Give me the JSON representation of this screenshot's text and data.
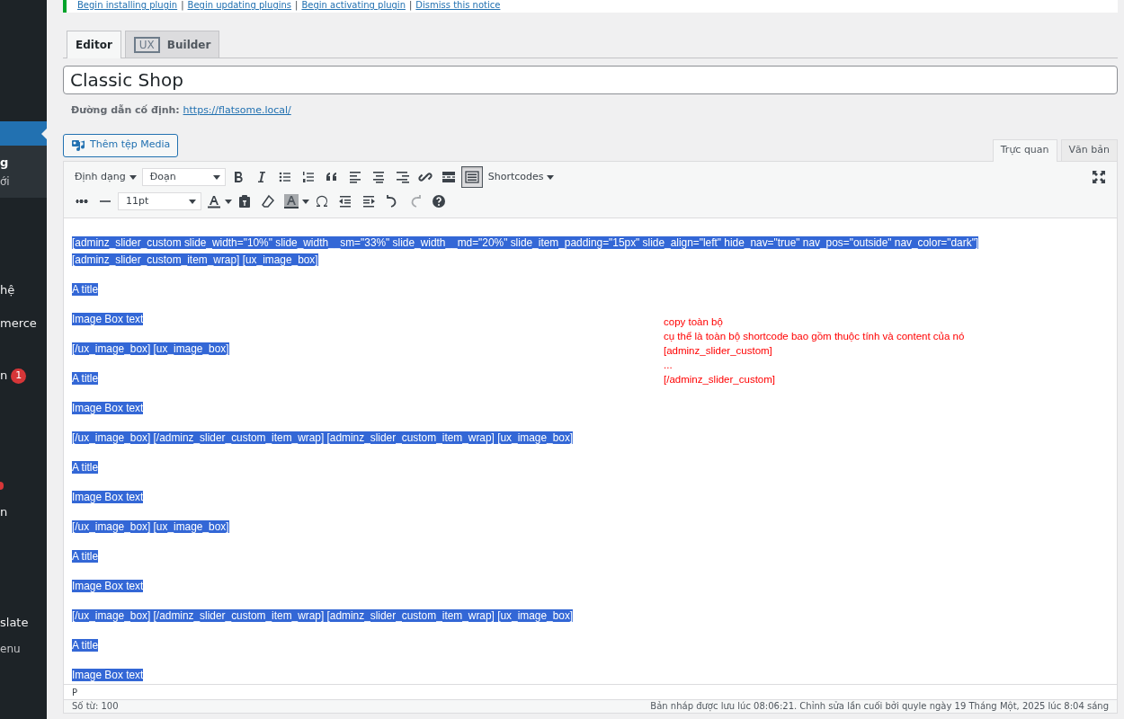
{
  "notice": {
    "links": [
      "Begin installing plugin",
      "Begin updating plugins",
      "Begin activating plugin",
      "Dismiss this notice"
    ],
    "separator": "|"
  },
  "sidebar": {
    "items": [
      {
        "kind": "current"
      },
      {
        "kind": "sub-current",
        "label": "g"
      },
      {
        "kind": "sub",
        "label": "ới"
      },
      {
        "kind": "menu",
        "label": "hệ"
      },
      {
        "kind": "menu",
        "label": "merce"
      },
      {
        "kind": "menu",
        "label": "n",
        "badge": "1"
      },
      {
        "kind": "dot"
      },
      {
        "kind": "menu",
        "label": "n"
      },
      {
        "kind": "menu",
        "label": "slate"
      },
      {
        "kind": "collapse",
        "label": "enu"
      }
    ]
  },
  "builder_tabs": [
    {
      "label": "Editor",
      "selected": true
    },
    {
      "label": "Builder",
      "logo": "UX",
      "selected": false
    }
  ],
  "title": {
    "value": "Classic Shop"
  },
  "permalink": {
    "label": "Đường dẫn cố định:",
    "url": "https://flatsome.local/"
  },
  "add_media": {
    "label": "Thêm tệp Media"
  },
  "editor_tabs": [
    {
      "label": "Trực quan",
      "selected": true
    },
    {
      "label": "Văn bản",
      "selected": false
    }
  ],
  "toolbar": {
    "format_menu": "Định dạng",
    "paragraph_select": "Đoạn",
    "shortcodes_menu": "Shortcodes",
    "font_size_select": "11pt",
    "kitchen_sink_on": true
  },
  "content": [
    {
      "text": "[adminz_slider_custom slide_width=\"10%\" slide_width__sm=\"33%\" slide_width__md=\"20%\" slide_item_padding=\"15px\" slide_align=\"left\" hide_nav=\"true\" nav_pos=\"outside\" nav_color=\"dark\"]",
      "second_line": "[adminz_slider_custom_item_wrap] [ux_image_box]",
      "selected": true
    },
    {
      "text": "A title",
      "selected": true
    },
    {
      "text": "Image Box text",
      "selected": true
    },
    {
      "text": "[/ux_image_box] [ux_image_box]",
      "selected": true
    },
    {
      "text": "A title",
      "selected": true
    },
    {
      "text": "Image Box text",
      "selected": true
    },
    {
      "text": "[/ux_image_box] [/adminz_slider_custom_item_wrap] [adminz_slider_custom_item_wrap] [ux_image_box]",
      "selected": true
    },
    {
      "text": "A title",
      "selected": true
    },
    {
      "text": "Image Box text",
      "selected": true
    },
    {
      "text": "[/ux_image_box] [ux_image_box]",
      "selected": true
    },
    {
      "text": "A title",
      "selected": true
    },
    {
      "text": "Image Box text",
      "selected": true
    },
    {
      "text": "[/ux_image_box] [/adminz_slider_custom_item_wrap] [adminz_slider_custom_item_wrap] [ux_image_box]",
      "selected": true
    },
    {
      "text": "A title",
      "selected": true
    },
    {
      "text": "Image Box text",
      "selected": true
    }
  ],
  "annotation": [
    "copy toàn bộ",
    "cụ thể là toàn bộ  shortcode bao gồm thuộc tính và content của nó",
    "[adminz_slider_custom]",
    "...",
    "[/adminz_slider_custom]"
  ],
  "path_bar": "P",
  "status_bar": {
    "word_count": "Số từ: 100",
    "saved": "Bản nháp được lưu lúc 08:06:21. Chỉnh sửa lần cuối bởi quyle ngày 19 Tháng Một, 2025 lúc 8:04 sáng"
  }
}
